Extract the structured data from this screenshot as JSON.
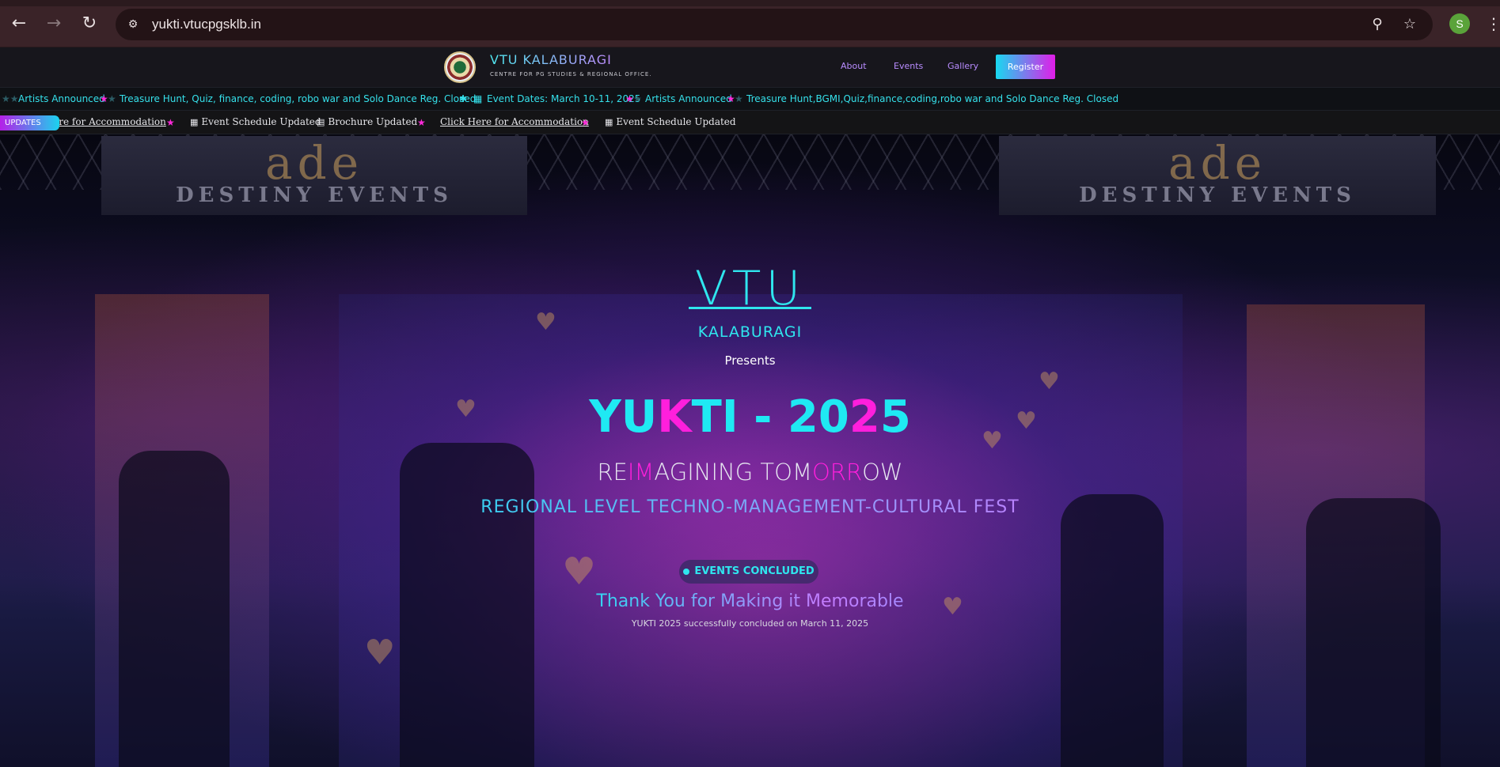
{
  "browser": {
    "url": "yukti.vtucpgsklb.in",
    "profile_initial": "S"
  },
  "nav": {
    "brand_title": "VTU KALABURAGI",
    "brand_subtitle": "CENTRE FOR PG STUDIES & REGIONAL OFFICE.",
    "links": [
      "About",
      "Events",
      "Gallery"
    ],
    "register_label": "Register"
  },
  "ticker1": {
    "items": [
      "Artists Announced",
      "Treasure Hunt, Quiz, finance, coding, robo war and Solo Dance Reg. Closed",
      "Event Dates: March 10-11, 2025",
      "Artists Announced",
      "Treasure Hunt,BGMI,Quiz,finance,coding,robo war and Solo Dance Reg. Closed"
    ]
  },
  "ticker2": {
    "badge": "UPDATES",
    "items": [
      "Click Here for Accommodation",
      "Event Schedule Updated",
      "Brochure Updated",
      "Click Here for Accommodation",
      "Event Schedule Updated"
    ]
  },
  "hero": {
    "banner_logo": "ade",
    "banner_name": "DESTINY EVENTS",
    "vtu": "VTU",
    "location": "KALABURAGI",
    "presents": "Presents",
    "fest_name_a": "YU",
    "fest_name_b": "K",
    "fest_name_c": "TI - 20",
    "fest_name_d": "2",
    "fest_name_e": "5",
    "tagline_a": "RE",
    "tagline_b": "IM",
    "tagline_c": "AGINING TOM",
    "tagline_d": "ORR",
    "tagline_e": "OW",
    "subtitle": "REGIONAL LEVEL TECHNO-MANAGEMENT-CULTURAL FEST",
    "status_pill": "EVENTS CONCLUDED",
    "thanks": "Thank You for Making it Memorable",
    "concluded_note": "YUKTI 2025 successfully concluded on March 11, 2025"
  },
  "colors": {
    "accent_cyan": "#2fe6ee",
    "accent_pink": "#ff1fdc",
    "accent_purple": "#b98cff"
  }
}
